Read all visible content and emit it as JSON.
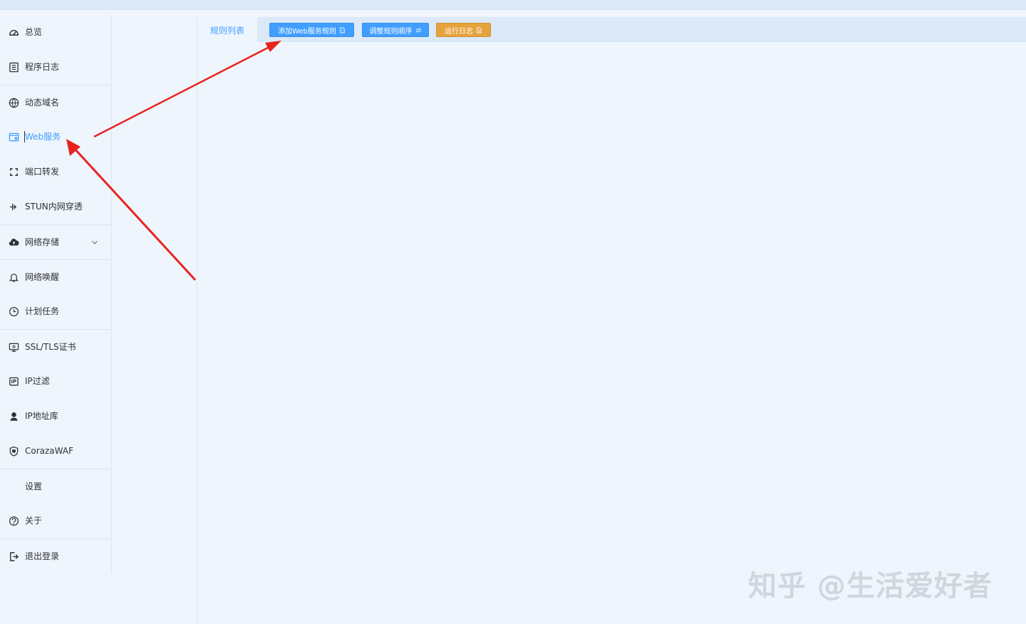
{
  "sidebar": {
    "items": [
      {
        "label": "总览",
        "icon": "dashboard-icon"
      },
      {
        "label": "程序日志",
        "icon": "log-icon"
      },
      {
        "label": "动态域名",
        "icon": "dns-icon"
      },
      {
        "label": "Web服务",
        "icon": "web-service-icon"
      },
      {
        "label": "端口转发",
        "icon": "port-forward-icon"
      },
      {
        "label": "STUN内网穿透",
        "icon": "stun-icon"
      },
      {
        "label": "网络存储",
        "icon": "cloud-icon"
      },
      {
        "label": "网络唤醒",
        "icon": "bell-icon"
      },
      {
        "label": "计划任务",
        "icon": "clock-icon"
      },
      {
        "label": "SSL/TLS证书",
        "icon": "certificate-icon"
      },
      {
        "label": "IP过滤",
        "icon": "ip-filter-icon"
      },
      {
        "label": "IP地址库",
        "icon": "ip-database-icon"
      },
      {
        "label": "CorazaWAF",
        "icon": "shield-icon"
      },
      {
        "label": "设置",
        "icon": ""
      },
      {
        "label": "关于",
        "icon": "about-icon"
      },
      {
        "label": "退出登录",
        "icon": "logout-icon"
      }
    ],
    "active_item": "Web服务"
  },
  "main": {
    "tab_label": "规则列表",
    "buttons": {
      "add_rule": "添加Web服务规则",
      "reorder": "调整规则顺序",
      "run_log": "运行日志"
    }
  },
  "watermark": "知乎 @生活爱好者",
  "colors": {
    "accent": "#409eff",
    "warning": "#e6a23c",
    "annotation_arrow": "#e8231e",
    "background": "#eef5fd"
  }
}
